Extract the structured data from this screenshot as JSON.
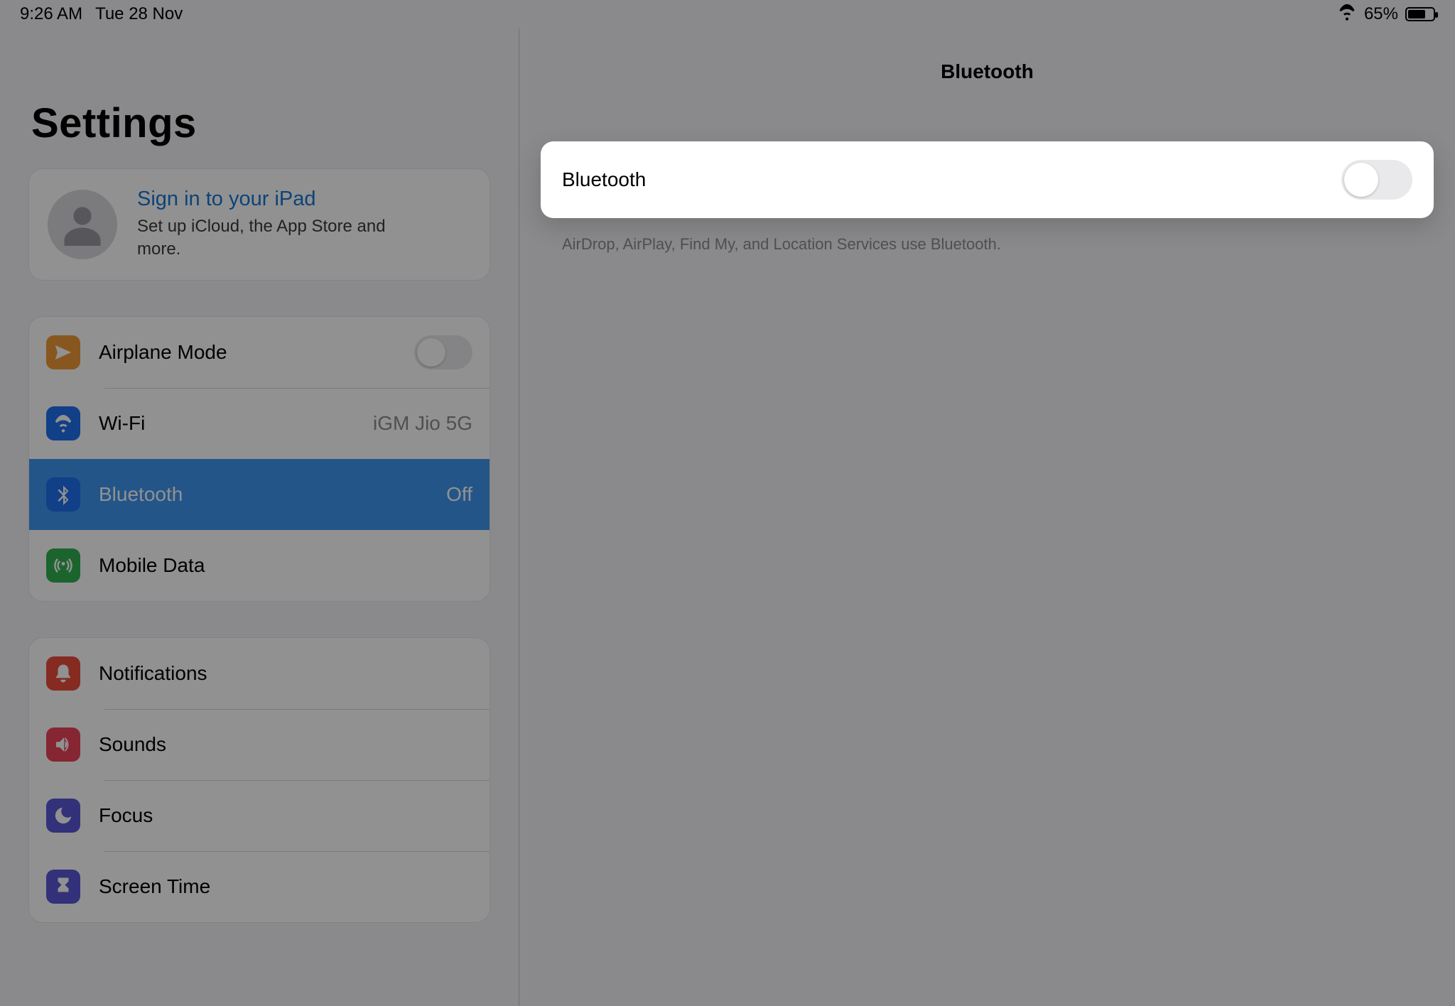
{
  "statusbar": {
    "time": "9:26 AM",
    "date": "Tue 28 Nov",
    "battery_pct": "65%"
  },
  "sidebar": {
    "title": "Settings",
    "signin": {
      "link": "Sign in to your iPad",
      "sub": "Set up iCloud, the App Store and more."
    },
    "group_net": {
      "airplane": "Airplane Mode",
      "wifi": "Wi-Fi",
      "wifi_value": "iGM Jio 5G",
      "bluetooth": "Bluetooth",
      "bluetooth_value": "Off",
      "mobile": "Mobile Data"
    },
    "group_sys": {
      "notifications": "Notifications",
      "sounds": "Sounds",
      "focus": "Focus",
      "screen_time": "Screen Time"
    }
  },
  "detail": {
    "title": "Bluetooth",
    "toggle_label": "Bluetooth",
    "footer": "AirDrop, AirPlay, Find My, and Location Services use Bluetooth."
  }
}
